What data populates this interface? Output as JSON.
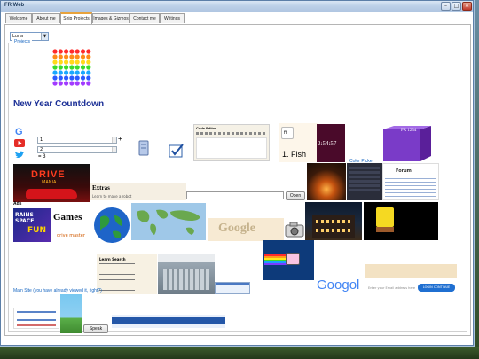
{
  "window": {
    "title": "FR Web",
    "controls": {
      "minimize": "–",
      "maximize": "□",
      "close": "✕"
    }
  },
  "tabs": [
    {
      "label": "Welcome",
      "active": false
    },
    {
      "label": "About me",
      "active": false
    },
    {
      "label": "Ship Projects",
      "active": true
    },
    {
      "label": "Images & Gizmos",
      "active": false
    },
    {
      "label": "Contact me",
      "active": false
    },
    {
      "label": "Writings",
      "active": false
    }
  ],
  "theme_select": {
    "value": "Luna"
  },
  "projects_group": {
    "label": "Projects",
    "heading": "New Year Countdown",
    "calc": {
      "input_a": "1",
      "input_b": "2",
      "operator": "+",
      "result": "= 3"
    },
    "code_editor_title": "Code Editor",
    "fish_label": "1. Fish",
    "fish_input": "fi",
    "clock": "2:54:57",
    "color_picker_link": "Color Picker",
    "cube_text": "FR 1234",
    "drive_mania_title": "DRIVE",
    "drive_mania_sub": "MANIA",
    "extras_title": "Extras",
    "extras_sub": "Learn to make a robot",
    "open_button": "Open",
    "ads_label": "Ads",
    "games_title": "Games",
    "games_sub": "drive master",
    "rains_space": "RAINS SPACE",
    "rains_fun": "FUN",
    "forum_title": "Forum",
    "learn_more": "Learn Search",
    "main_site_link": "Main Site (you have already viewed it, right?)",
    "speak_button": "Speak",
    "googol_text": "Googol",
    "google_word": "Google",
    "continue_button": "LOGIN CONTINUE",
    "email_placeholder": "Enter your Email address here"
  },
  "colors": {
    "accent": "#1b2f96",
    "link": "#1565c0",
    "tab_highlight": "#e8a33d"
  }
}
